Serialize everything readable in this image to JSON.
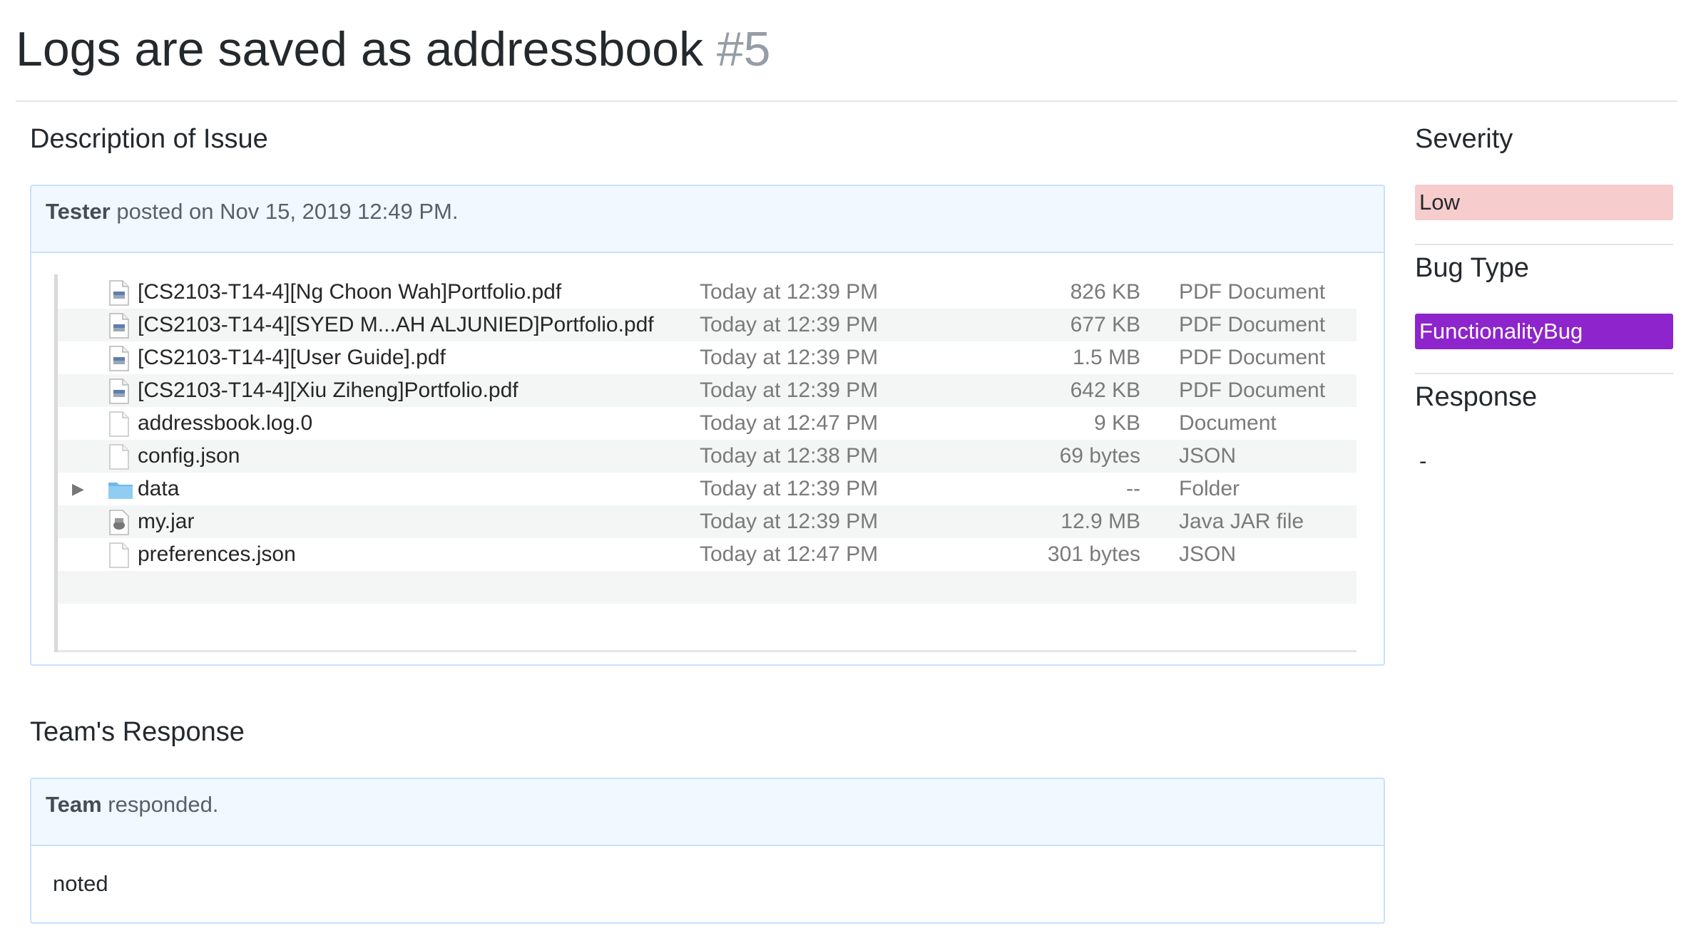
{
  "issue": {
    "title": "Logs are saved as addressbook",
    "number": "#5"
  },
  "description": {
    "heading": "Description of Issue",
    "author": "Tester",
    "posted_text": " posted on Nov 15, 2019 12:49 PM."
  },
  "files": [
    {
      "name": "[CS2103-T14-4][Ng Choon Wah]Portfolio.pdf",
      "date": "Today at 12:39 PM",
      "size": "826 KB",
      "kind": "PDF Document",
      "icon": "pdf-icon"
    },
    {
      "name": "[CS2103-T14-4][SYED M...AH ALJUNIED]Portfolio.pdf",
      "date": "Today at 12:39 PM",
      "size": "677 KB",
      "kind": "PDF Document",
      "icon": "pdf-icon"
    },
    {
      "name": "[CS2103-T14-4][User Guide].pdf",
      "date": "Today at 12:39 PM",
      "size": "1.5 MB",
      "kind": "PDF Document",
      "icon": "pdf-icon"
    },
    {
      "name": "[CS2103-T14-4][Xiu Ziheng]Portfolio.pdf",
      "date": "Today at 12:39 PM",
      "size": "642 KB",
      "kind": "PDF Document",
      "icon": "pdf-icon"
    },
    {
      "name": "addressbook.log.0",
      "date": "Today at 12:47 PM",
      "size": "9 KB",
      "kind": "Document",
      "icon": "document-icon"
    },
    {
      "name": "config.json",
      "date": "Today at 12:38 PM",
      "size": "69 bytes",
      "kind": "JSON",
      "icon": "document-icon"
    },
    {
      "name": "data",
      "date": "Today at 12:39 PM",
      "size": "--",
      "kind": "Folder",
      "icon": "folder-icon",
      "disclosure": "▶"
    },
    {
      "name": "my.jar",
      "date": "Today at 12:39 PM",
      "size": "12.9 MB",
      "kind": "Java JAR file",
      "icon": "jar-icon"
    },
    {
      "name": "preferences.json",
      "date": "Today at 12:47 PM",
      "size": "301 bytes",
      "kind": "JSON",
      "icon": "document-icon"
    }
  ],
  "team_response": {
    "heading": "Team's Response",
    "author": "Team",
    "responded_text": " responded.",
    "body": "noted"
  },
  "sidebar": {
    "severity_heading": "Severity",
    "severity_value": "Low",
    "severity_color": "#f6cccc",
    "bug_type_heading": "Bug Type",
    "bug_type_value": "FunctionalityBug",
    "bug_type_color": "#8e24cc",
    "response_heading": "Response",
    "response_value": "-"
  }
}
